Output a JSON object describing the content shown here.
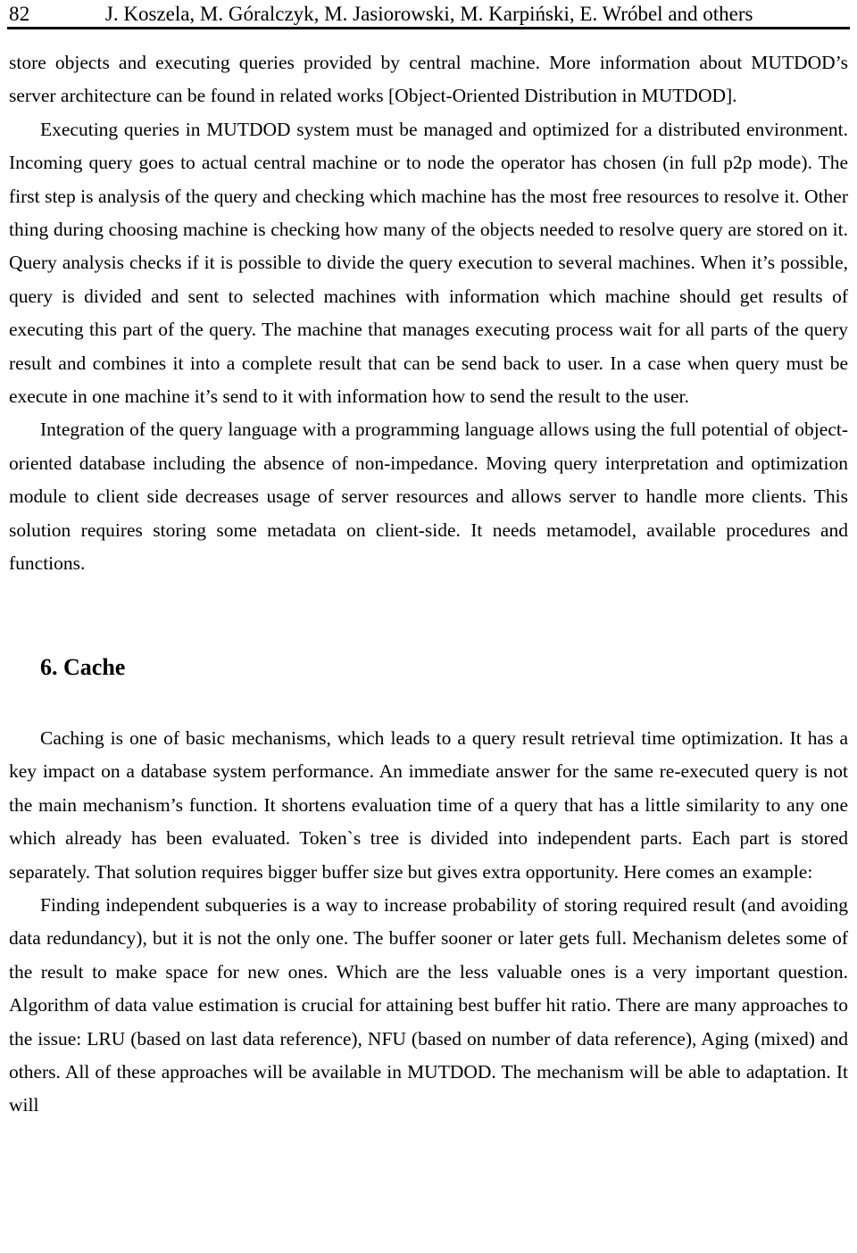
{
  "page": {
    "folio": "82",
    "running_head": "J. Koszela, M. Góralczyk, M. Jasiorowski, M. Karpiński, E. Wróbel and others"
  },
  "content": {
    "paragraph_1": "store objects and executing queries provided by central machine. More information about MUTDOD’s server architecture can be found in related works [Object-Oriented Distribution in MUTDOD].",
    "paragraph_2": "Executing queries in MUTDOD system must be managed and optimized for a distributed environment. Incoming query goes to actual central machine or to node the operator has chosen (in full p2p mode). The first step is analysis of the query and checking which machine has the most free resources to resolve it. Other thing during choosing machine is checking how many of the objects needed to resolve query are stored on it. Query analysis checks if it is possible to divide the query execution to several machines. When it’s possible, query is divided and sent to selected machines with information which machine should get results of executing this part of the query. The machine that manages executing process wait for all parts of the query result and combines it into a complete result that can be send back to user. In a case when query must be execute in one machine it’s send to it with information how to send the result to the user.",
    "paragraph_3": "Integration of the query language with a programming language allows using the full potential of object-oriented database including the absence of non-impedance. Moving query interpretation and optimization module to client side decreases usage of server resources and allows server to handle more clients. This solution requires storing some metadata on client-side. It needs metamodel, available procedures and functions.",
    "section_heading": "6. Cache",
    "paragraph_4": "Caching is one of basic mechanisms, which leads to a query result retrieval time optimization. It has a key impact on a database system performance.  An immediate answer for the same re-executed query is not the main mechanism’s function. It shortens evaluation time of a query that has a little similarity to any one which already has been evaluated. Token`s tree is divided into independent parts. Each part is stored separately. That solution requires bigger buffer size but gives extra opportunity. Here comes an example:",
    "paragraph_5": "Finding independent subqueries is a way to increase probability of storing required result (and avoiding data redundancy), but it is not the only one. The buffer sooner or later gets full. Mechanism deletes some of the result to make space for new ones. Which are the less valuable ones is a very important question. Algorithm of data value estimation is crucial for attaining best buffer hit ratio. There are many approaches to the issue: LRU (based on last data reference), NFU (based on number of data reference), Aging (mixed) and others. All of these approaches will be available in MUTDOD. The mechanism will be able to adaptation. It will"
  }
}
